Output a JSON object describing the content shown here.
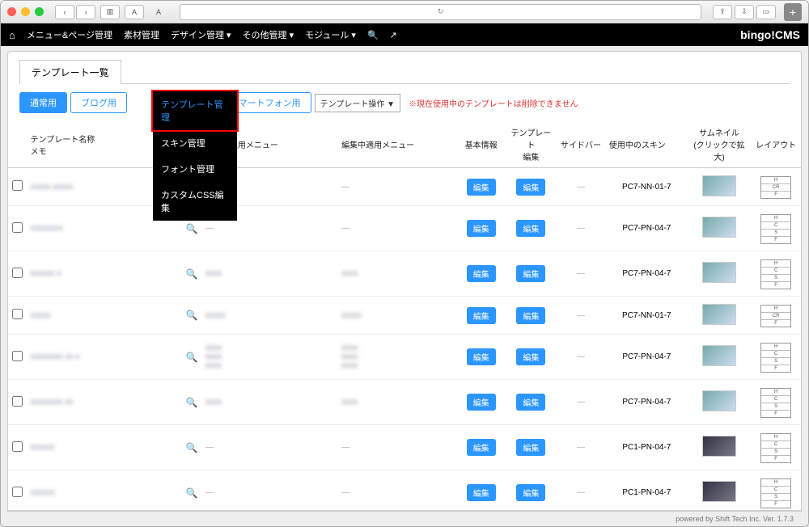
{
  "brand": "bingo!CMS",
  "warn_text": "※現在使用中のテンプレートは削除できません",
  "tab_title": "テンプレート一覧",
  "template_op_label": "テンプレート操作 ▼",
  "topmenu": [
    "メニュー&ページ管理",
    "素材管理",
    "デザイン管理 ▾",
    "その他管理 ▾",
    "モジュール ▾"
  ],
  "dropdown": [
    "テンプレート管理",
    "スキン管理",
    "フォント管理",
    "カスタムCSS編集"
  ],
  "filter_pills": [
    "通常用",
    "ブログ用",
    "スマートフォン用"
  ],
  "columns": [
    "",
    "テンプレート名称\nメモ",
    "",
    "公開中適用メニュー",
    "編集中適用メニュー",
    "基本情報",
    "テンプレート\n編集",
    "サイドバー",
    "使用中のスキン",
    "サムネイル\n(クリックで拡大)",
    "レイアウト"
  ],
  "edit_label": "編集",
  "rows": [
    {
      "name": "xxxxx xxxxx",
      "pub": "—",
      "edit": "—",
      "skin": "PC7-NN-01-7",
      "layout": [
        "H",
        "CR",
        "F"
      ],
      "thumb": "a"
    },
    {
      "name": "xxxxxxxx",
      "pub": "—",
      "edit": "—",
      "skin": "PC7-PN-04-7",
      "layout": [
        "H",
        "C",
        "S",
        "F"
      ],
      "thumb": "b"
    },
    {
      "name": "xxxxxx x",
      "pub": "xxxx",
      "edit": "xxxx",
      "skin": "PC7-PN-04-7",
      "layout": [
        "H",
        "C",
        "S",
        "F"
      ],
      "thumb": "b"
    },
    {
      "name": "xxxxx",
      "pub": "xxxxx",
      "edit": "xxxxx",
      "skin": "PC7-NN-01-7",
      "layout": [
        "H",
        "CR",
        "F"
      ],
      "thumb": "a"
    },
    {
      "name": "xxxxxxxx xx x",
      "pub": "xxxx\nxxxx\nxxxx",
      "edit": "xxxx\nxxxx\nxxxx",
      "skin": "PC7-PN-04-7",
      "layout": [
        "H",
        "C",
        "S",
        "F"
      ],
      "thumb": "b"
    },
    {
      "name": "xxxxxxxx xx",
      "pub": "xxxx",
      "edit": "xxxx",
      "skin": "PC7-PN-04-7",
      "layout": [
        "H",
        "C",
        "S",
        "F"
      ],
      "thumb": "b"
    },
    {
      "name": "xxxxxx",
      "pub": "—",
      "edit": "—",
      "skin": "PC1-PN-04-7",
      "layout": [
        "H",
        "C",
        "S",
        "F"
      ],
      "thumb": "c"
    },
    {
      "name": "xxxxxx",
      "pub": "—",
      "edit": "—",
      "skin": "PC1-PN-04-7",
      "layout": [
        "H",
        "C",
        "S",
        "F"
      ],
      "thumb": "c"
    }
  ],
  "footer": "powered by Shift Tech Inc. Ver. 1.7.3"
}
